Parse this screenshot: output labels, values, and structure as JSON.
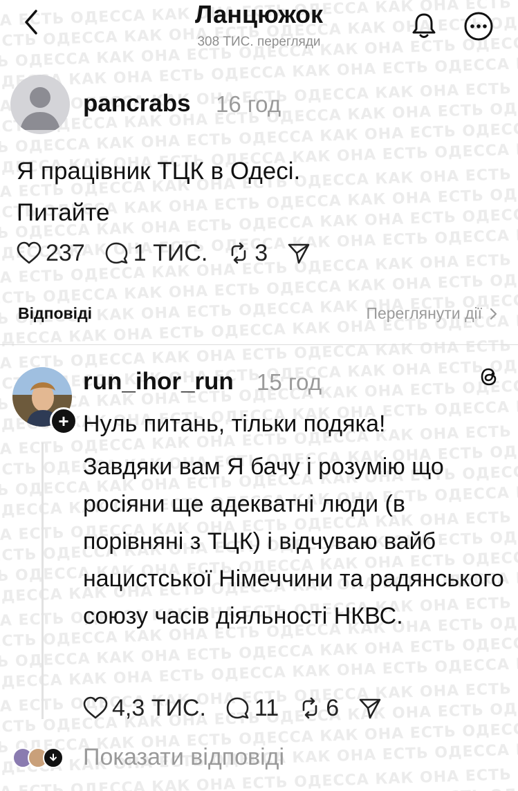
{
  "header": {
    "title": "Ланцюжок",
    "views": "308 ТИС. перегляди"
  },
  "watermark_text": "НА ЕСТЬ ОДЕССА КАК ОНА ЕСТЬ ОДЕССА КАК ОНА ЕСТЬ ОДЕССА КАК ОНА ЕСТЬ ОДЕССА КАК ОНА ЕСТЬ",
  "post": {
    "author": "pancrabs",
    "time": "16 год",
    "text_line1": "Я працівник ТЦК в Одесі.",
    "text_line2": "Питайте",
    "likes": "237",
    "comments": "1 ТИС.",
    "reposts": "3"
  },
  "replies_section": {
    "label": "Відповіді",
    "view_actions": "Переглянути дії"
  },
  "reply": {
    "author": "run_ihor_run",
    "time": "15 год",
    "paragraph1": "Нуль питань, тільки подяка!",
    "paragraph2": "Завдяки вам Я бачу і розумію що росіяни ще адекватні люди (в порівняні з ТЦК) і відчуваю вайб нацистської Німеччини та радянського союзу часів діяльності НКВС.",
    "likes": "4,3 ТИС.",
    "comments": "11",
    "reposts": "6"
  },
  "show_replies": "Показати відповіді",
  "icons": [
    "back-icon",
    "bell-icon",
    "more-icon",
    "heart-icon",
    "comment-icon",
    "repost-icon",
    "share-icon",
    "threads-icon",
    "chevron-right-icon",
    "plus-icon",
    "download-icon"
  ]
}
